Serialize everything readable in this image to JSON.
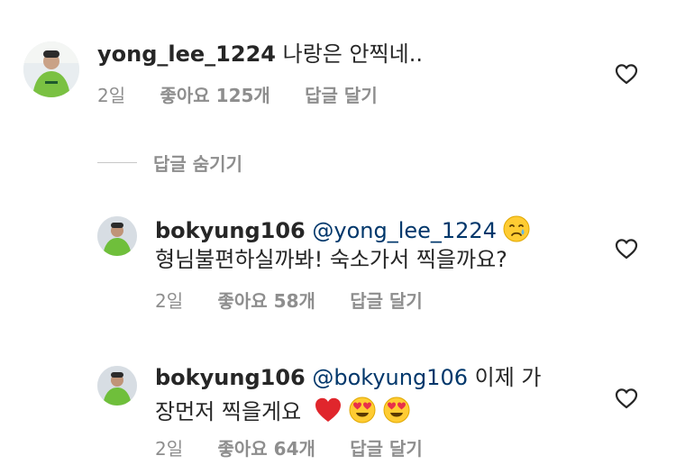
{
  "comments": [
    {
      "username": "yong_lee_1224",
      "text": " 나랑은 안찍네..",
      "time": "2일",
      "likes": "좋아요 125개",
      "reply": "답글 달기"
    },
    {
      "username": "bokyung106",
      "mention": " @yong_lee_1224",
      "emoji_after_mention": "crying-face",
      "text_line2": "형님불편하실까봐! 숙소가서 찍을까요?",
      "time": "2일",
      "likes": "좋아요 58개",
      "reply": "답글 달기"
    },
    {
      "username": "bokyung106",
      "mention": " @bokyung106",
      "text_line1_after": " 이제 가",
      "text_line2": "장먼저 찍을게요 ",
      "emojis": [
        "red-heart",
        "heart-eyes",
        "heart-eyes"
      ],
      "time": "2일",
      "likes": "좋아요 64개",
      "reply": "답글 달기"
    }
  ],
  "hide_replies_label": "답글 숨기기",
  "icons": {
    "like": "heart-outline-icon"
  },
  "colors": {
    "mention": "#00376b",
    "meta": "#8e8e8e",
    "text": "#262626"
  }
}
